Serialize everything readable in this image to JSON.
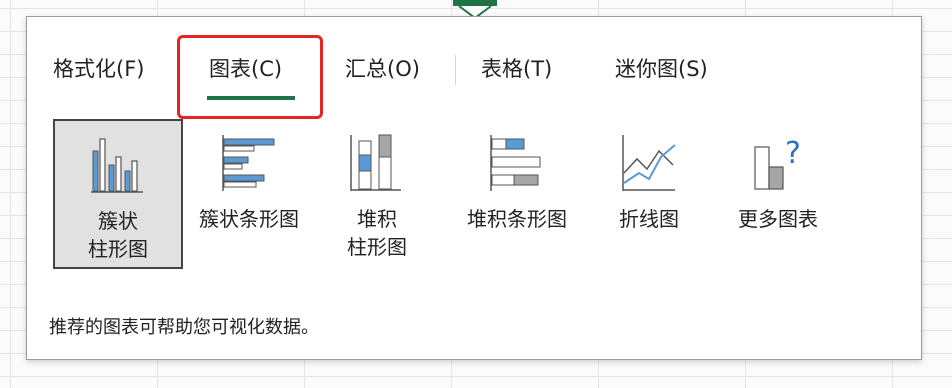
{
  "tabs": [
    {
      "label": "格式化(F)",
      "active": false
    },
    {
      "label": "图表(C)",
      "active": true
    },
    {
      "label": "汇总(O)",
      "active": false
    },
    {
      "label": "表格(T)",
      "active": false
    },
    {
      "label": "迷你图(S)",
      "active": false
    }
  ],
  "chart_options": [
    {
      "label": "簇状\n柱形图",
      "icon": "clustered-column-chart-icon",
      "selected": true
    },
    {
      "label": "簇状条形图",
      "icon": "clustered-bar-chart-icon",
      "selected": false
    },
    {
      "label": "堆积\n柱形图",
      "icon": "stacked-column-chart-icon",
      "selected": false
    },
    {
      "label": "堆积条形图",
      "icon": "stacked-bar-chart-icon",
      "selected": false
    },
    {
      "label": "折线图",
      "icon": "line-chart-icon",
      "selected": false
    },
    {
      "label": "更多图表",
      "icon": "more-charts-icon",
      "selected": false
    }
  ],
  "description": "推荐的图表可帮助您可视化数据。",
  "colors": {
    "accent": "#217346",
    "highlight": "#e52521",
    "chart_blue": "#5b9bd5",
    "chart_gray": "#a6a6a6"
  }
}
